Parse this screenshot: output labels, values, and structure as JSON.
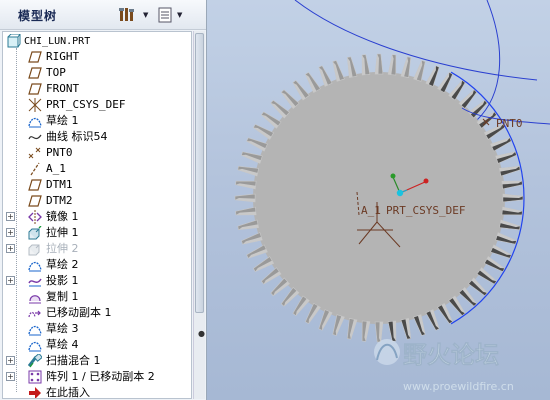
{
  "tree_panel": {
    "title": "模型树",
    "items": [
      {
        "label": "CHI_LUN.PRT",
        "icon": "part-icon"
      },
      {
        "label": "RIGHT",
        "icon": "datum-plane-icon"
      },
      {
        "label": "TOP",
        "icon": "datum-plane-icon"
      },
      {
        "label": "FRONT",
        "icon": "datum-plane-icon"
      },
      {
        "label": "PRT_CSYS_DEF",
        "icon": "coordinate-system-icon"
      },
      {
        "label": "草绘 1",
        "icon": "sketch-icon"
      },
      {
        "label": "曲线 标识54",
        "icon": "curve-icon"
      },
      {
        "label": "PNT0",
        "icon": "datum-point-icon"
      },
      {
        "label": "A_1",
        "icon": "datum-axis-icon"
      },
      {
        "label": "DTM1",
        "icon": "datum-plane-icon"
      },
      {
        "label": "DTM2",
        "icon": "datum-plane-icon"
      },
      {
        "label": "镜像 1",
        "icon": "mirror-icon"
      },
      {
        "label": "拉伸 1",
        "icon": "extrude-icon"
      },
      {
        "label": "拉伸 2",
        "icon": "extrude-icon",
        "suppressed": true
      },
      {
        "label": "草绘 2",
        "icon": "sketch-icon"
      },
      {
        "label": "投影 1",
        "icon": "projection-icon"
      },
      {
        "label": "复制 1",
        "icon": "copy-icon"
      },
      {
        "label": "已移动副本 1",
        "icon": "moved-copy-icon"
      },
      {
        "label": "草绘 3",
        "icon": "sketch-icon"
      },
      {
        "label": "草绘 4",
        "icon": "sketch-icon"
      },
      {
        "label": "扫描混合 1",
        "icon": "swept-blend-icon"
      },
      {
        "label": "阵列 1 / 已移动副本 2",
        "icon": "pattern-icon"
      },
      {
        "label": "在此插入",
        "icon": "insert-here-arrow-icon"
      }
    ]
  },
  "viewport": {
    "point_label": "PNT0",
    "axis_label": "A_1",
    "csys_label": "PRT_CSYS_DEF",
    "gear_teeth": 60,
    "colors": {
      "gear_face": "#b4b4b4",
      "gear_tooth_dark": "#4a4a4a",
      "edge_highlight": "#2244ee",
      "datum_label": "#6b3a24",
      "background_top": "#c2d1e6",
      "background_bottom": "#a6b8d4"
    }
  },
  "watermark": {
    "title": "野火论坛",
    "url": "www.proewildfire.cn"
  }
}
